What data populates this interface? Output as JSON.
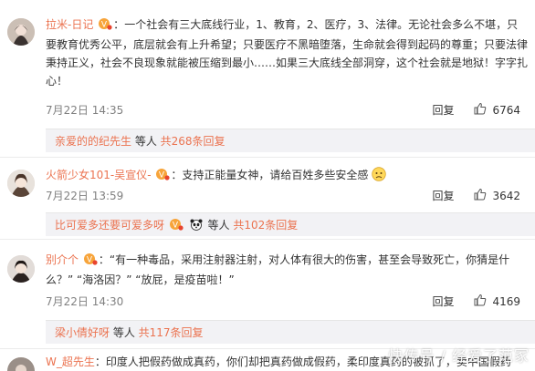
{
  "comments": [
    {
      "user": "拉米-日记",
      "separator": "：",
      "text": "一个社会有三大底线行业，1、教育，2、医疗，3、法律。无论社会多么不堪，只要教育优秀公平，底层就会有上升希望；只要医疗不黑暗堕落，生命就会得到起码的尊重；只要法律秉持正义，社会不良现象就能被压缩到最小……如果三大底线全部洞穿，这个社会就是地狱！字字扎心！",
      "time": "7月22日 14:35",
      "reply_label": "回复",
      "likes": "6764",
      "sub": {
        "who": "亲爱的的纪先生",
        "mid": " 等人 ",
        "count": "共268条回复"
      }
    },
    {
      "user": "火箭少女101-吴宣仪-",
      "separator": "：",
      "text": "支持正能量女神，请给百姓多些安全感",
      "time": "7月22日 13:59",
      "reply_label": "回复",
      "likes": "3642",
      "sub": {
        "who": "比可爱多还要可爱多呀",
        "mid": " 等人 ",
        "count": "共102条回复"
      }
    },
    {
      "user": "别介个",
      "separator": "：",
      "text": "“有一种毒品，采用注射器注射，对人体有很大的伤害，甚至会导致死亡，你猜是什么？” “海洛因？” “放屁，是疫苗啦！”",
      "time": "7月22日 14:30",
      "reply_label": "回复",
      "likes": "4169",
      "sub": {
        "who": "梁小倩好呀",
        "mid": " 等人 ",
        "count": "共117条回复"
      }
    },
    {
      "user": "W_超先生",
      "separator": "：",
      "text": "印度人把假药做成真药，你们却把真药做成假药，柔印度真药的被抓了，卖中国假药"
    }
  ],
  "watermark": "快传号 / 经爱了范冢",
  "colors": {
    "username": "#eb7350",
    "sub_bg": "#f2f2f5",
    "time": "#808080"
  },
  "icons": [
    "verified-badge-icon",
    "thumb-up-icon",
    "panda-icon",
    "worried-face-icon"
  ]
}
